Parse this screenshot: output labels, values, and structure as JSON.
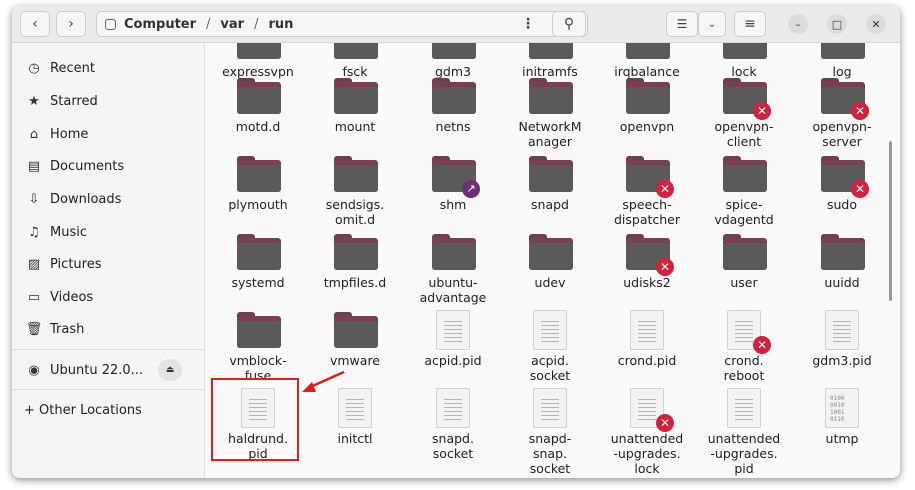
{
  "header": {
    "path": [
      "Computer",
      "var",
      "run"
    ],
    "separator": "/",
    "icons": {
      "back": "chevron-left-icon",
      "forward": "chevron-right-icon",
      "drive": "drive-icon",
      "menu": "kebab-menu-icon",
      "search": "search-icon",
      "list_view": "list-view-icon",
      "view_options": "chevron-down-icon",
      "main_menu": "hamburger-menu-icon",
      "minimize": "minimize-icon",
      "maximize": "maximize-icon",
      "close": "close-icon"
    }
  },
  "sidebar": {
    "items": [
      {
        "label": "Recent",
        "icon": "clock-icon"
      },
      {
        "label": "Starred",
        "icon": "star-icon"
      },
      {
        "label": "Home",
        "icon": "home-icon"
      },
      {
        "label": "Documents",
        "icon": "document-icon"
      },
      {
        "label": "Downloads",
        "icon": "download-icon"
      },
      {
        "label": "Music",
        "icon": "music-icon"
      },
      {
        "label": "Pictures",
        "icon": "picture-icon"
      },
      {
        "label": "Videos",
        "icon": "video-icon"
      },
      {
        "label": "Trash",
        "icon": "trash-icon"
      }
    ],
    "volume": {
      "label": "Ubuntu 22.0...",
      "icon": "disc-icon",
      "eject_icon": "eject-icon"
    },
    "other": {
      "label": "+ Other Locations",
      "icon": "plus-icon"
    }
  },
  "files": [
    {
      "name": "expressvpn",
      "type": "folder",
      "badge": "none"
    },
    {
      "name": "fsck",
      "type": "folder",
      "badge": "none"
    },
    {
      "name": "gdm3",
      "type": "folder",
      "badge": "none"
    },
    {
      "name": "initramfs",
      "type": "folder",
      "badge": "none"
    },
    {
      "name": "irqbalance",
      "type": "folder",
      "badge": "none"
    },
    {
      "name": "lock",
      "type": "folder",
      "badge": "none"
    },
    {
      "name": "log",
      "type": "folder",
      "badge": "none"
    },
    {
      "name": "motd.d",
      "type": "folder",
      "badge": "none"
    },
    {
      "name": "mount",
      "type": "folder",
      "badge": "none"
    },
    {
      "name": "netns",
      "type": "folder",
      "badge": "none"
    },
    {
      "name": "NetworkM\nanager",
      "type": "folder",
      "badge": "none"
    },
    {
      "name": "openvpn",
      "type": "folder",
      "badge": "none"
    },
    {
      "name": "openvpn-\nclient",
      "type": "folder",
      "badge": "x"
    },
    {
      "name": "openvpn-\nserver",
      "type": "folder",
      "badge": "x"
    },
    {
      "name": "plymouth",
      "type": "folder",
      "badge": "none"
    },
    {
      "name": "sendsigs.\nomit.d",
      "type": "folder",
      "badge": "none"
    },
    {
      "name": "shm",
      "type": "folder",
      "badge": "link"
    },
    {
      "name": "snapd",
      "type": "folder",
      "badge": "none"
    },
    {
      "name": "speech-\ndispatcher",
      "type": "folder",
      "badge": "x"
    },
    {
      "name": "spice-\nvdagentd",
      "type": "folder",
      "badge": "none"
    },
    {
      "name": "sudo",
      "type": "folder",
      "badge": "x"
    },
    {
      "name": "systemd",
      "type": "folder",
      "badge": "none"
    },
    {
      "name": "tmpfiles.d",
      "type": "folder",
      "badge": "none"
    },
    {
      "name": "ubuntu-\nadvantage",
      "type": "folder",
      "badge": "none"
    },
    {
      "name": "udev",
      "type": "folder",
      "badge": "none"
    },
    {
      "name": "udisks2",
      "type": "folder",
      "badge": "x"
    },
    {
      "name": "user",
      "type": "folder",
      "badge": "none"
    },
    {
      "name": "uuidd",
      "type": "folder",
      "badge": "none"
    },
    {
      "name": "vmblock-\nfuse",
      "type": "folder",
      "badge": "none"
    },
    {
      "name": "vmware",
      "type": "folder",
      "badge": "none"
    },
    {
      "name": "acpid.pid",
      "type": "file",
      "badge": "none"
    },
    {
      "name": "acpid.\nsocket",
      "type": "file",
      "badge": "none"
    },
    {
      "name": "crond.pid",
      "type": "file",
      "badge": "none"
    },
    {
      "name": "crond.\nreboot",
      "type": "file",
      "badge": "x"
    },
    {
      "name": "gdm3.pid",
      "type": "file",
      "badge": "none"
    },
    {
      "name": "haldrund.\npid",
      "type": "file",
      "badge": "none"
    },
    {
      "name": "initctl",
      "type": "file",
      "badge": "none"
    },
    {
      "name": "snapd.\nsocket",
      "type": "file",
      "badge": "none"
    },
    {
      "name": "snapd-\nsnap.\nsocket",
      "type": "file",
      "badge": "none"
    },
    {
      "name": "unattended\n-upgrades.\nlock",
      "type": "file",
      "badge": "x"
    },
    {
      "name": "unattended\n-upgrades.\npid",
      "type": "file",
      "badge": "none"
    },
    {
      "name": "utmp",
      "type": "binary",
      "badge": "none"
    }
  ],
  "binary_glyph": "0100\n0010\n1001\n0110",
  "highlight_color": "#e0201c"
}
